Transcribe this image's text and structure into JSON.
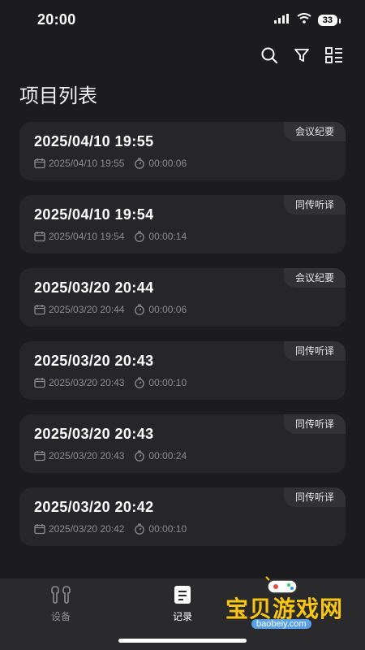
{
  "status": {
    "time": "20:00",
    "battery": "33"
  },
  "toolbar": {
    "icons": [
      "search-icon",
      "filter-icon",
      "list-view-icon"
    ]
  },
  "page": {
    "title": "项目列表"
  },
  "items": [
    {
      "title": "2025/04/10 19:55",
      "date": "2025/04/10 19:55",
      "duration": "00:00:06",
      "tag": "会议纪要"
    },
    {
      "title": "2025/04/10 19:54",
      "date": "2025/04/10 19:54",
      "duration": "00:00:14",
      "tag": "同传听译"
    },
    {
      "title": "2025/03/20 20:44",
      "date": "2025/03/20 20:44",
      "duration": "00:00:06",
      "tag": "会议纪要"
    },
    {
      "title": "2025/03/20 20:43",
      "date": "2025/03/20 20:43",
      "duration": "00:00:10",
      "tag": "同传听译"
    },
    {
      "title": "2025/03/20 20:43",
      "date": "2025/03/20 20:43",
      "duration": "00:00:24",
      "tag": "同传听译"
    },
    {
      "title": "2025/03/20 20:42",
      "date": "2025/03/20 20:42",
      "duration": "00:00:10",
      "tag": "同传听译"
    }
  ],
  "tabs": [
    {
      "label": "设备",
      "icon": "earbuds-icon",
      "active": false
    },
    {
      "label": "记录",
      "icon": "document-icon",
      "active": true
    }
  ],
  "watermark": {
    "text": "宝贝游戏网",
    "url": "baobeiy.com"
  },
  "colors": {
    "background": "#1c1c1e",
    "card": "#262629",
    "tag": "#323236",
    "muted": "#8c8c8f",
    "watermark": "#f5c518"
  }
}
